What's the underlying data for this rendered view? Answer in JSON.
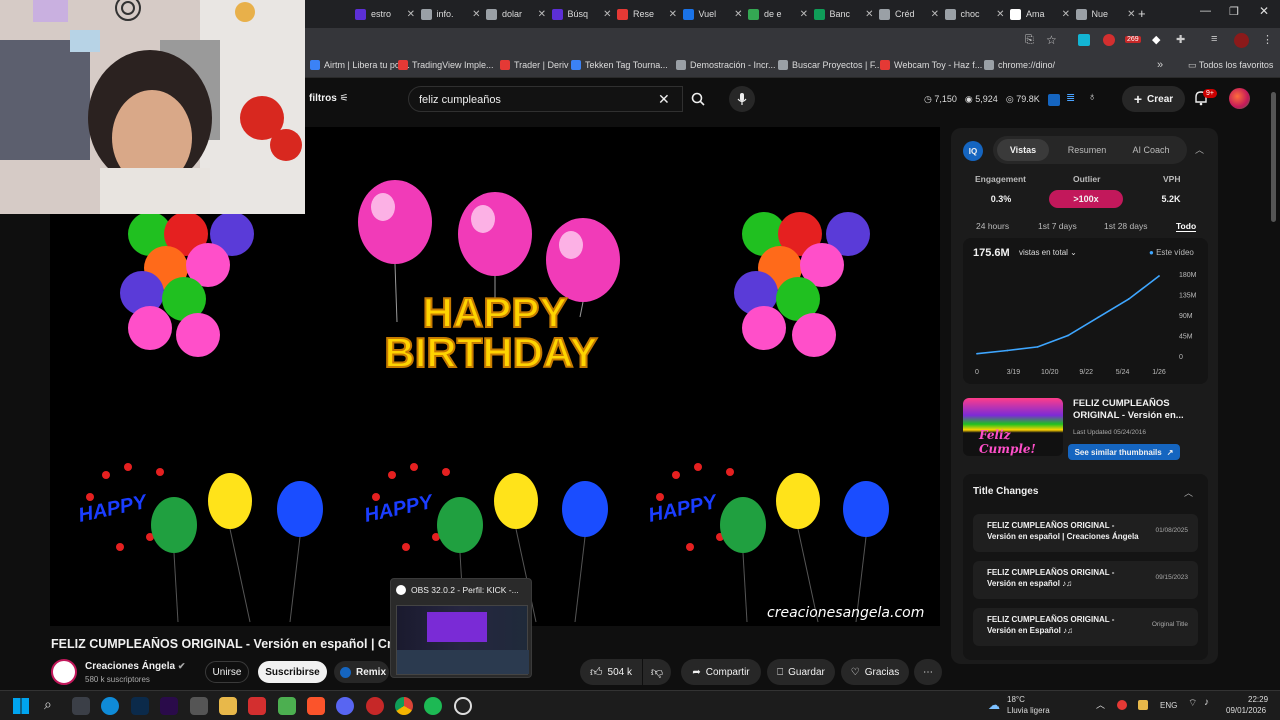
{
  "browser": {
    "tabs": [
      {
        "label": "estro",
        "color": "#5c2fd6"
      },
      {
        "label": "info.",
        "color": "#9aa0a6"
      },
      {
        "label": "dolar",
        "color": "#9aa0a6"
      },
      {
        "label": "Búsq",
        "color": "#5c2fd6"
      },
      {
        "label": "Rese",
        "color": "#e53935"
      },
      {
        "label": "Vuel",
        "color": "#1a73e8"
      },
      {
        "label": "de e",
        "color": "#34a853"
      },
      {
        "label": "Banc",
        "color": "#0f9d58"
      },
      {
        "label": "Créd",
        "color": "#9aa0a6"
      },
      {
        "label": "choc",
        "color": "#9aa0a6"
      },
      {
        "label": "Ama",
        "color": "#ffffff"
      },
      {
        "label": "Nue",
        "color": "#9aa0a6"
      }
    ],
    "bookmarks": [
      {
        "label": "Airtm | Libera tu pot...",
        "color": "#3b82f6"
      },
      {
        "label": "TradingView Imple...",
        "color": "#e53935"
      },
      {
        "label": "Trader | Deriv",
        "color": "#e53935"
      },
      {
        "label": "Tekken Tag Tourna...",
        "color": "#3b82f6"
      },
      {
        "label": "Demostración - Incr...",
        "color": "#9aa0a6"
      },
      {
        "label": "Buscar Proyectos | F...",
        "color": "#9aa0a6"
      },
      {
        "label": "Webcam Toy - Haz f...",
        "color": "#e53935"
      },
      {
        "label": "chrome://dino/",
        "color": "#9aa0a6"
      }
    ],
    "all_bookmarks": "Todos los favoritos",
    "ext_badge": "269"
  },
  "youtube": {
    "filters_label": "filtros",
    "search_value": "feliz cumpleaños",
    "stats": {
      "a": "7,150",
      "b": "5,924",
      "c": "79.8K"
    },
    "create_label": "Crear",
    "notif_badge": "9+",
    "video_title": "FELIZ CUMPLEAÑOS ORIGINAL - Versión en español | Cr",
    "watermark": "creacionesangela.com",
    "channel_name": "Creaciones Ángela",
    "subscribers": "580 k suscriptores",
    "join_label": "Unirse",
    "subscribe_label": "Suscribirse",
    "remix_label": "Remix",
    "likes": "504 k",
    "share_label": "Compartir",
    "save_label": "Guardar",
    "thanks_label": "Gracias",
    "video_text": {
      "happy": "HAPPY",
      "birthday": "BIRTHDAY",
      "small_happy": "HAPPY"
    }
  },
  "obs_popup": {
    "title": "OBS 32.0.2 - Perfil: KICK -..."
  },
  "panel": {
    "logo": "IQ",
    "tabs": [
      "Vistas",
      "Resumen",
      "AI Coach"
    ],
    "metrics": [
      {
        "label": "Engagement",
        "value": "0.3%"
      },
      {
        "label": "Outlier",
        "value": ">100x"
      },
      {
        "label": "VPH",
        "value": "5.2K"
      }
    ],
    "ranges": [
      "24 hours",
      "1st 7 days",
      "1st 28 days",
      "Todo"
    ],
    "total_views": "175.6M",
    "views_select": "vistas en total",
    "legend": "Este vídeo",
    "thumb_title": "FELIZ CUMPLEAÑOS ORIGINAL - Versión en...",
    "thumb_text": "Feliz Cumple!",
    "last_updated": "Last Updated 05/24/2016",
    "similar_label": "See similar thumbnails",
    "title_changes_heading": "Title Changes",
    "title_changes": [
      {
        "title": "FELIZ CUMPLEAÑOS ORIGINAL - Versión en español | Creaciones Ángela",
        "date": "01/08/2025"
      },
      {
        "title": "FELIZ CUMPLEAÑOS ORIGINAL - Versión en español ♪♫",
        "date": "09/15/2023"
      },
      {
        "title": "FELIZ CUMPLEAÑOS ORIGINAL - Versión en Español ♪♫",
        "date": "Original Title"
      }
    ]
  },
  "chart_data": {
    "type": "line",
    "x": [
      "0",
      "3/19",
      "10/20",
      "9/22",
      "5/24",
      "1/26"
    ],
    "yticks": [
      "180M",
      "135M",
      "90M",
      "45M",
      "0"
    ],
    "ylim": [
      0,
      180
    ],
    "series": [
      {
        "name": "Este vídeo",
        "color": "#3ea6ff",
        "values": [
          5,
          12,
          20,
          45,
          85,
          125,
          175.6
        ]
      }
    ]
  },
  "taskbar": {
    "weather_temp": "18°C",
    "weather_desc": "Lluvia ligera",
    "lang": "ENG",
    "time": "22:29",
    "date": "09/01/2026"
  }
}
